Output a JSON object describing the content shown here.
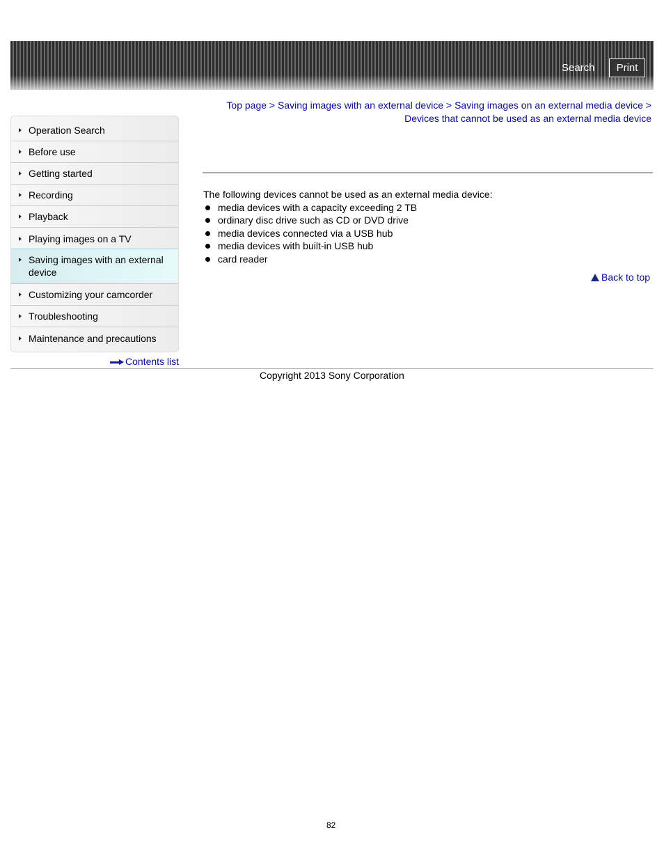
{
  "header": {
    "search_label": "Search",
    "print_label": "Print"
  },
  "sidebar": {
    "items": [
      {
        "label": "Operation Search"
      },
      {
        "label": "Before use"
      },
      {
        "label": "Getting started"
      },
      {
        "label": "Recording"
      },
      {
        "label": "Playback"
      },
      {
        "label": "Playing images on a TV"
      },
      {
        "label": "Saving images with an external device",
        "active": true
      },
      {
        "label": "Customizing your camcorder"
      },
      {
        "label": "Troubleshooting"
      },
      {
        "label": "Maintenance and precautions"
      }
    ],
    "contents_link": "Contents list"
  },
  "breadcrumb": {
    "items": [
      "Top page",
      "Saving images with an external device",
      "Saving images on an external media device",
      "Devices that cannot be used as an external media device"
    ],
    "separator": ">"
  },
  "content": {
    "intro": "The following devices cannot be used as an external media device:",
    "list": [
      "media devices with a capacity exceeding 2 TB",
      "ordinary disc drive such as CD or DVD drive",
      "media devices connected via a USB hub",
      "media devices with built-in USB hub",
      "card reader"
    ],
    "back_to_top": "Back to top"
  },
  "footer": {
    "copyright": "Copyright 2013 Sony Corporation",
    "page_number": "82"
  }
}
